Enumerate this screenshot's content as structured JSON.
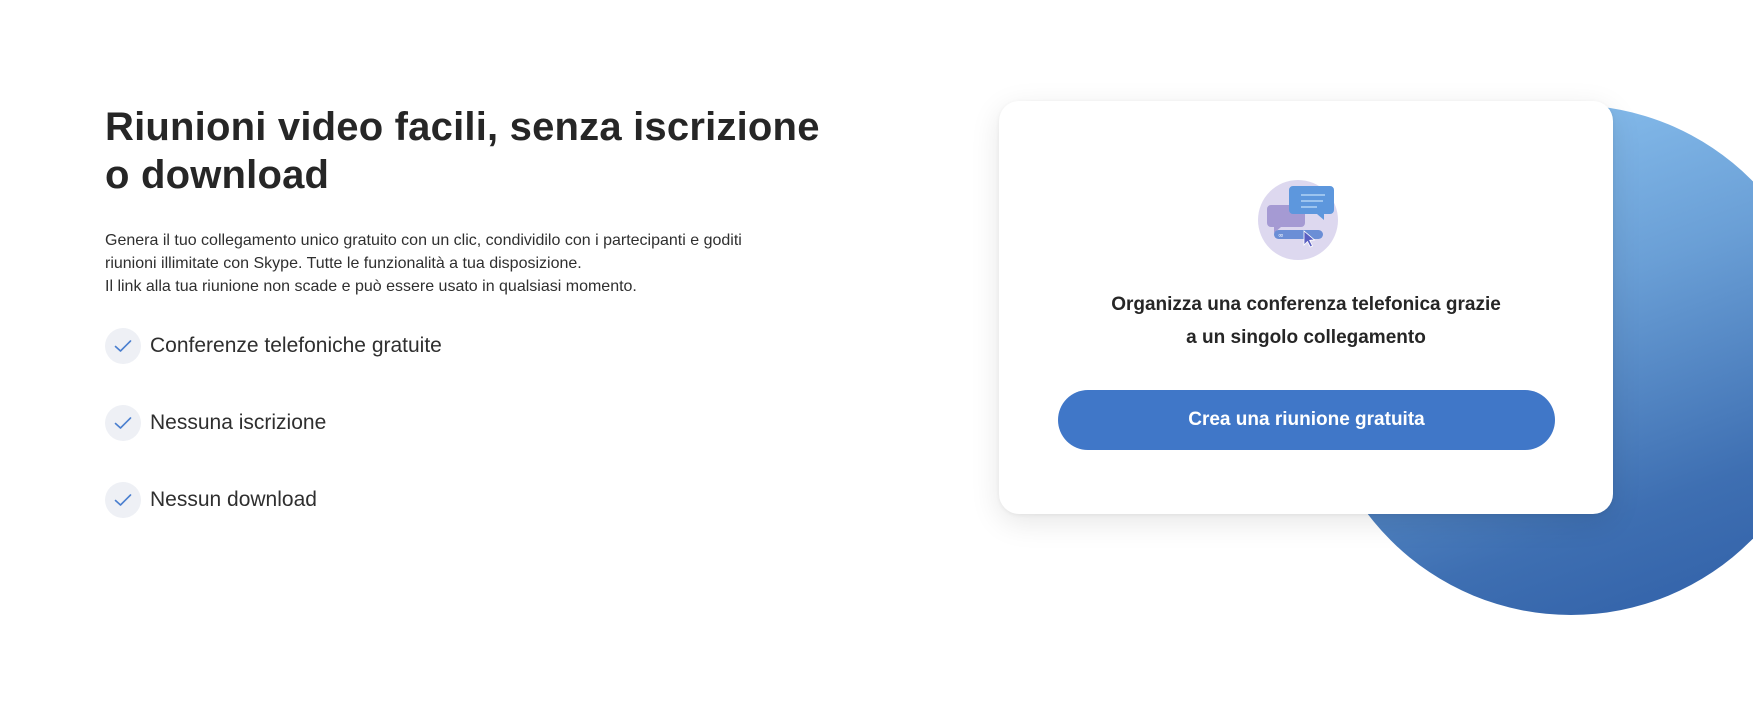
{
  "hero": {
    "title_line1": "Riunioni video facili, senza iscrizione",
    "title_line2": "o download",
    "description_line1": "Genera il tuo collegamento unico gratuito con un clic, condividilo con i partecipanti e goditi",
    "description_line2": "riunioni illimitate con Skype. Tutte le funzionalità a tua disposizione.",
    "description_line3": "Il link alla tua riunione non scade e può essere usato in qualsiasi momento."
  },
  "features": [
    {
      "label": "Conferenze telefoniche gratuite",
      "icon": "check-icon"
    },
    {
      "label": "Nessuna iscrizione",
      "icon": "check-icon"
    },
    {
      "label": "Nessun download",
      "icon": "check-icon"
    }
  ],
  "card": {
    "illustration_icon": "chat-bubbles-cursor-icon",
    "text_line1": "Organizza una conferenza telefonica grazie",
    "text_line2": "a un singolo collegamento",
    "button_label": "Crea una riunione gratuita"
  },
  "colors": {
    "accent": "#4077c8",
    "circle_light": "#92c9f5",
    "circle_dark": "#2f5ea6",
    "check": "#4a7fcf"
  }
}
